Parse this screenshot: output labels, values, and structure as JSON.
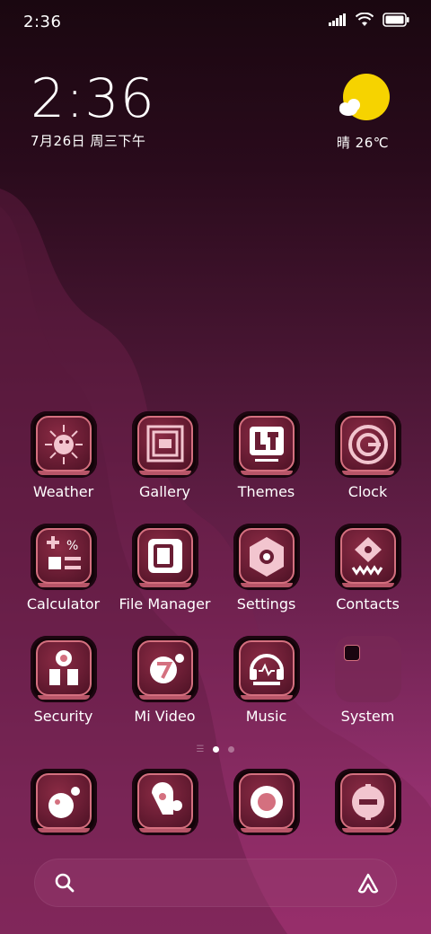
{
  "status": {
    "time": "2:36",
    "icons": [
      "signal-icon",
      "wifi-icon",
      "battery-icon"
    ]
  },
  "clock_widget": {
    "time": "2:36",
    "date": "7月26日 周三下午"
  },
  "weather_widget": {
    "icon": "sun-cloud-icon",
    "text": "晴 26℃"
  },
  "apps": [
    {
      "label": "Weather",
      "icon": "weather-icon"
    },
    {
      "label": "Gallery",
      "icon": "gallery-icon"
    },
    {
      "label": "Themes",
      "icon": "themes-icon"
    },
    {
      "label": "Clock",
      "icon": "clock-icon"
    },
    {
      "label": "Calculator",
      "icon": "calculator-icon"
    },
    {
      "label": "File Manager",
      "icon": "file-manager-icon"
    },
    {
      "label": "Settings",
      "icon": "settings-icon"
    },
    {
      "label": "Contacts",
      "icon": "contacts-icon"
    },
    {
      "label": "Security",
      "icon": "security-icon"
    },
    {
      "label": "Mi Video",
      "icon": "mi-video-icon"
    },
    {
      "label": "Music",
      "icon": "music-icon"
    },
    {
      "label": "System",
      "icon": "folder-icon"
    }
  ],
  "pager": {
    "pages": 2,
    "current": 1
  },
  "dock": [
    {
      "icon": "dock-app-1-icon"
    },
    {
      "icon": "dock-app-2-icon"
    },
    {
      "icon": "dock-app-3-icon"
    },
    {
      "icon": "dock-app-4-icon"
    }
  ],
  "search": {
    "icon": "search-icon",
    "assistant": "assistant-icon"
  },
  "colors": {
    "accent": "#d4707f",
    "tile_bg": "#6a1d34",
    "sun": "#f6d300"
  }
}
